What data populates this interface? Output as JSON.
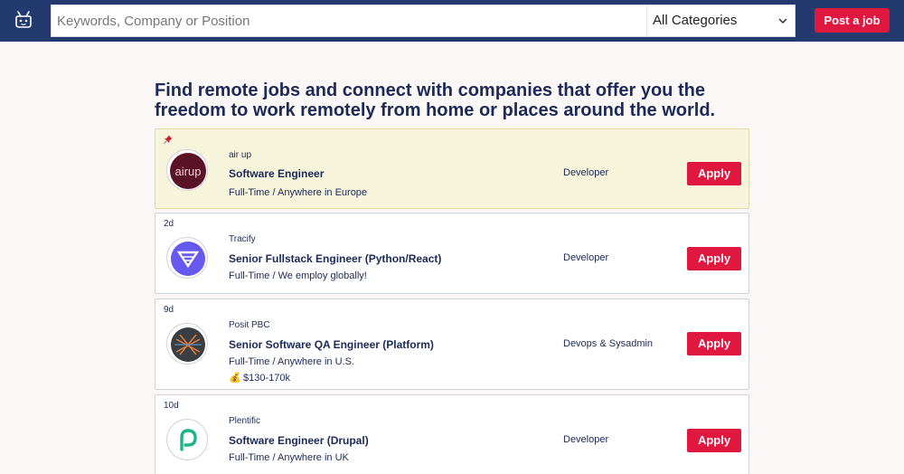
{
  "header": {
    "logo_icon": "robot-icon",
    "search_placeholder": "Keywords, Company or Position",
    "category_selected": "All Categories",
    "post_job_label": "Post a job"
  },
  "headline": "Find remote jobs and connect with companies that offer you the freedom to work remotely from home or places around the world.",
  "jobs": [
    {
      "pinned": true,
      "age": "",
      "company": "air up",
      "title": "Software Engineer",
      "meta": "Full-Time / Anywhere in Europe",
      "category": "Developer",
      "apply": "Apply",
      "logo_text": "airup"
    },
    {
      "pinned": false,
      "age": "2d",
      "company": "Tracify",
      "title": "Senior Fullstack Engineer (Python/React)",
      "meta": "Full-Time / We employ globally!",
      "category": "Developer",
      "apply": "Apply"
    },
    {
      "pinned": false,
      "age": "9d",
      "company": "Posit PBC",
      "title": "Senior Software QA Engineer (Platform)",
      "meta": "Full-Time / Anywhere in U.S.",
      "salary": "$130-170k",
      "category": "Devops & Sysadmin",
      "apply": "Apply"
    },
    {
      "pinned": false,
      "age": "10d",
      "company": "Plentific",
      "title": "Software Engineer (Drupal)",
      "meta": "Full-Time / Anywhere in UK",
      "category": "Developer",
      "apply": "Apply"
    }
  ],
  "colors": {
    "nav": "#233a6f",
    "accent": "#e0173f",
    "pinned_bg": "#f7f4dc",
    "text": "#1b2a57"
  }
}
